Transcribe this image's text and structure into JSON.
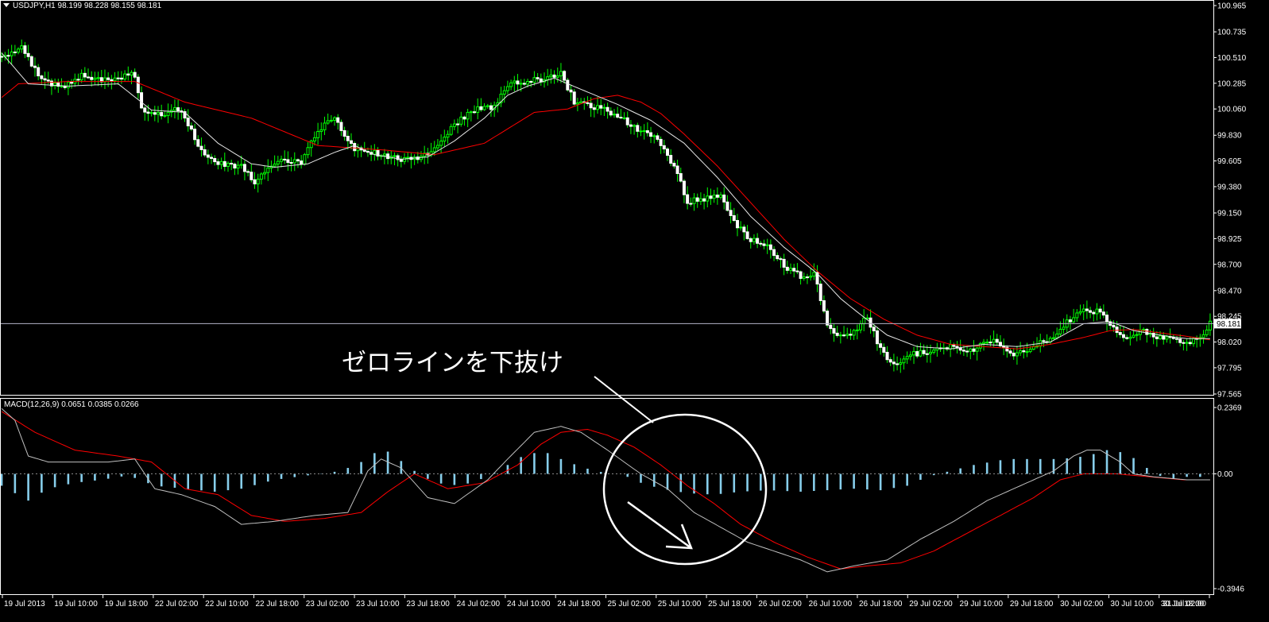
{
  "chart_data": {
    "type": "candlestick",
    "main": {
      "header": "USDJPY,H1  98.199 98.228 98.155 98.181",
      "ylim": [
        97.565,
        100.965
      ],
      "y_ticks": [
        "100.965",
        "100.735",
        "100.510",
        "100.285",
        "100.060",
        "99.830",
        "99.605",
        "99.380",
        "99.150",
        "98.925",
        "98.700",
        "98.470",
        "98.245",
        "98.020",
        "97.795",
        "97.565"
      ],
      "current_price": "98.181",
      "colors": {
        "bull": "#00ff00",
        "bear": "#ffffff",
        "ma_fast": "#e6e6e6",
        "ma_slow": "#ff0000",
        "grid": "#b4b4c8"
      },
      "close_path": [
        [
          0,
          100.52
        ],
        [
          6,
          100.6
        ],
        [
          12,
          100.3
        ],
        [
          18,
          100.25
        ],
        [
          24,
          100.35
        ],
        [
          30,
          100.32
        ],
        [
          36,
          100.34
        ],
        [
          40,
          100.36
        ],
        [
          42,
          100.05
        ],
        [
          48,
          100.02
        ],
        [
          54,
          100.06
        ],
        [
          60,
          99.68
        ],
        [
          66,
          99.58
        ],
        [
          72,
          99.56
        ],
        [
          76,
          99.42
        ],
        [
          80,
          99.54
        ],
        [
          85,
          99.62
        ],
        [
          90,
          99.58
        ],
        [
          95,
          99.88
        ],
        [
          100,
          99.98
        ],
        [
          106,
          99.7
        ],
        [
          112,
          99.68
        ],
        [
          120,
          99.62
        ],
        [
          126,
          99.64
        ],
        [
          131,
          99.74
        ],
        [
          136,
          99.93
        ],
        [
          142,
          100.05
        ],
        [
          148,
          100.08
        ],
        [
          152,
          100.28
        ],
        [
          158,
          100.3
        ],
        [
          164,
          100.33
        ],
        [
          168,
          100.38
        ],
        [
          172,
          100.12
        ],
        [
          178,
          100.08
        ],
        [
          184,
          100.02
        ],
        [
          190,
          99.9
        ],
        [
          196,
          99.82
        ],
        [
          202,
          99.56
        ],
        [
          206,
          99.25
        ],
        [
          212,
          99.28
        ],
        [
          216,
          99.3
        ],
        [
          220,
          99.06
        ],
        [
          225,
          98.92
        ],
        [
          230,
          98.88
        ],
        [
          235,
          98.68
        ],
        [
          240,
          98.6
        ],
        [
          244,
          98.62
        ],
        [
          248,
          98.15
        ],
        [
          252,
          98.06
        ],
        [
          256,
          98.1
        ],
        [
          260,
          98.25
        ],
        [
          264,
          97.95
        ],
        [
          268,
          97.82
        ],
        [
          272,
          97.9
        ],
        [
          280,
          97.95
        ],
        [
          286,
          97.98
        ],
        [
          292,
          97.95
        ],
        [
          298,
          98.05
        ],
        [
          304,
          97.92
        ],
        [
          310,
          97.98
        ],
        [
          315,
          98.05
        ],
        [
          320,
          98.2
        ],
        [
          325,
          98.3
        ],
        [
          330,
          98.28
        ],
        [
          334,
          98.13
        ],
        [
          338,
          98.03
        ],
        [
          342,
          98.12
        ],
        [
          347,
          98.05
        ],
        [
          352,
          98.06
        ],
        [
          356,
          98.02
        ],
        [
          360,
          98.05
        ],
        [
          363,
          98.181
        ]
      ],
      "sma_fast": [
        [
          0,
          100.55
        ],
        [
          8,
          100.28
        ],
        [
          20,
          100.26
        ],
        [
          35,
          100.28
        ],
        [
          45,
          100.05
        ],
        [
          55,
          100.03
        ],
        [
          65,
          99.76
        ],
        [
          75,
          99.58
        ],
        [
          82,
          99.55
        ],
        [
          92,
          99.58
        ],
        [
          100,
          99.68
        ],
        [
          106,
          99.74
        ],
        [
          112,
          99.66
        ],
        [
          120,
          99.62
        ],
        [
          128,
          99.64
        ],
        [
          136,
          99.78
        ],
        [
          145,
          99.98
        ],
        [
          152,
          100.18
        ],
        [
          158,
          100.26
        ],
        [
          166,
          100.33
        ],
        [
          175,
          100.22
        ],
        [
          185,
          100.1
        ],
        [
          195,
          99.96
        ],
        [
          205,
          99.76
        ],
        [
          215,
          99.46
        ],
        [
          225,
          99.12
        ],
        [
          235,
          98.85
        ],
        [
          245,
          98.62
        ],
        [
          252,
          98.4
        ],
        [
          258,
          98.26
        ],
        [
          266,
          98.08
        ],
        [
          275,
          97.98
        ],
        [
          285,
          97.96
        ],
        [
          295,
          98.0
        ],
        [
          305,
          97.98
        ],
        [
          315,
          98.02
        ],
        [
          325,
          98.18
        ],
        [
          333,
          98.2
        ],
        [
          340,
          98.12
        ],
        [
          348,
          98.08
        ],
        [
          356,
          98.05
        ],
        [
          363,
          98.05
        ]
      ],
      "sma_slow": [
        [
          0,
          100.16
        ],
        [
          5,
          100.28
        ],
        [
          20,
          100.3
        ],
        [
          40,
          100.3
        ],
        [
          55,
          100.12
        ],
        [
          75,
          99.98
        ],
        [
          95,
          99.74
        ],
        [
          115,
          99.7
        ],
        [
          130,
          99.66
        ],
        [
          145,
          99.76
        ],
        [
          160,
          100.03
        ],
        [
          170,
          100.06
        ],
        [
          178,
          100.15
        ],
        [
          185,
          100.18
        ],
        [
          192,
          100.12
        ],
        [
          198,
          100.02
        ],
        [
          205,
          99.84
        ],
        [
          215,
          99.56
        ],
        [
          225,
          99.24
        ],
        [
          235,
          98.92
        ],
        [
          245,
          98.64
        ],
        [
          255,
          98.4
        ],
        [
          265,
          98.22
        ],
        [
          275,
          98.08
        ],
        [
          285,
          98.0
        ],
        [
          295,
          97.98
        ],
        [
          305,
          97.96
        ],
        [
          315,
          98.0
        ],
        [
          325,
          98.06
        ],
        [
          333,
          98.12
        ],
        [
          340,
          98.13
        ],
        [
          348,
          98.1
        ],
        [
          356,
          98.07
        ],
        [
          363,
          98.04
        ]
      ]
    },
    "macd": {
      "header": "MACD(12,26,9) 0.0651 0.0385 0.0266",
      "ylim": [
        -0.3946,
        0.2369
      ],
      "y_ticks": [
        "0.2369",
        "0.00",
        "-0.3946"
      ],
      "zero_label": "0.00",
      "colors": {
        "histogram": "#87ceeb",
        "signal": "#ff0000",
        "macd_line": "#c0c0c0"
      },
      "histogram_path": [
        [
          0,
          -0.04
        ],
        [
          8,
          -0.09
        ],
        [
          14,
          -0.05
        ],
        [
          22,
          -0.03
        ],
        [
          30,
          -0.02
        ],
        [
          38,
          -0.005
        ],
        [
          46,
          -0.04
        ],
        [
          55,
          -0.05
        ],
        [
          64,
          -0.06
        ],
        [
          72,
          -0.05
        ],
        [
          82,
          -0.02
        ],
        [
          92,
          -0.005
        ],
        [
          102,
          0.01
        ],
        [
          110,
          0.05
        ],
        [
          114,
          0.09
        ],
        [
          118,
          0.06
        ],
        [
          124,
          0.01
        ],
        [
          130,
          -0.03
        ],
        [
          138,
          -0.04
        ],
        [
          146,
          -0.01
        ],
        [
          152,
          0.03
        ],
        [
          158,
          0.07
        ],
        [
          164,
          0.07
        ],
        [
          170,
          0.04
        ],
        [
          178,
          0.01
        ],
        [
          184,
          0.0
        ],
        [
          188,
          -0.01
        ],
        [
          192,
          -0.03
        ],
        [
          198,
          -0.05
        ],
        [
          206,
          -0.065
        ],
        [
          214,
          -0.07
        ],
        [
          222,
          -0.06
        ],
        [
          230,
          -0.055
        ],
        [
          240,
          -0.06
        ],
        [
          248,
          -0.055
        ],
        [
          256,
          -0.05
        ],
        [
          264,
          -0.055
        ],
        [
          272,
          -0.04
        ],
        [
          278,
          -0.01
        ],
        [
          285,
          0.01
        ],
        [
          292,
          0.03
        ],
        [
          302,
          0.05
        ],
        [
          310,
          0.05
        ],
        [
          318,
          0.05
        ],
        [
          326,
          0.06
        ],
        [
          332,
          0.08
        ],
        [
          338,
          0.07
        ],
        [
          344,
          0.02
        ],
        [
          350,
          -0.02
        ],
        [
          356,
          -0.01
        ],
        [
          363,
          -0.01
        ]
      ],
      "signal_path": [
        [
          0,
          0.21
        ],
        [
          10,
          0.14
        ],
        [
          22,
          0.08
        ],
        [
          35,
          0.06
        ],
        [
          45,
          0.04
        ],
        [
          55,
          -0.05
        ],
        [
          65,
          -0.07
        ],
        [
          75,
          -0.14
        ],
        [
          85,
          -0.16
        ],
        [
          97,
          -0.15
        ],
        [
          108,
          -0.13
        ],
        [
          116,
          -0.06
        ],
        [
          124,
          0.0
        ],
        [
          134,
          -0.05
        ],
        [
          145,
          -0.03
        ],
        [
          155,
          0.03
        ],
        [
          162,
          0.1
        ],
        [
          168,
          0.14
        ],
        [
          176,
          0.15
        ],
        [
          182,
          0.13
        ],
        [
          190,
          0.09
        ],
        [
          198,
          0.03
        ],
        [
          206,
          -0.04
        ],
        [
          214,
          -0.1
        ],
        [
          222,
          -0.17
        ],
        [
          232,
          -0.23
        ],
        [
          242,
          -0.28
        ],
        [
          252,
          -0.32
        ],
        [
          260,
          -0.31
        ],
        [
          270,
          -0.3
        ],
        [
          280,
          -0.26
        ],
        [
          290,
          -0.2
        ],
        [
          300,
          -0.14
        ],
        [
          310,
          -0.08
        ],
        [
          318,
          -0.02
        ],
        [
          325,
          0.0
        ],
        [
          335,
          0.0
        ],
        [
          345,
          -0.01
        ],
        [
          355,
          -0.02
        ],
        [
          363,
          -0.02
        ]
      ],
      "macd_line_path": [
        [
          0,
          0.22
        ],
        [
          4,
          0.18
        ],
        [
          8,
          0.06
        ],
        [
          14,
          0.04
        ],
        [
          24,
          0.04
        ],
        [
          32,
          0.04
        ],
        [
          40,
          0.05
        ],
        [
          46,
          -0.05
        ],
        [
          54,
          -0.07
        ],
        [
          64,
          -0.11
        ],
        [
          72,
          -0.17
        ],
        [
          82,
          -0.16
        ],
        [
          94,
          -0.14
        ],
        [
          104,
          -0.13
        ],
        [
          110,
          0.01
        ],
        [
          114,
          0.05
        ],
        [
          120,
          0.02
        ],
        [
          128,
          -0.08
        ],
        [
          136,
          -0.1
        ],
        [
          146,
          -0.02
        ],
        [
          152,
          0.05
        ],
        [
          160,
          0.14
        ],
        [
          168,
          0.16
        ],
        [
          174,
          0.14
        ],
        [
          182,
          0.08
        ],
        [
          192,
          0.0
        ],
        [
          200,
          -0.05
        ],
        [
          208,
          -0.13
        ],
        [
          216,
          -0.18
        ],
        [
          224,
          -0.23
        ],
        [
          232,
          -0.26
        ],
        [
          240,
          -0.29
        ],
        [
          248,
          -0.33
        ],
        [
          256,
          -0.31
        ],
        [
          266,
          -0.29
        ],
        [
          276,
          -0.22
        ],
        [
          286,
          -0.16
        ],
        [
          296,
          -0.09
        ],
        [
          306,
          -0.04
        ],
        [
          316,
          0.01
        ],
        [
          322,
          0.06
        ],
        [
          326,
          0.08
        ],
        [
          330,
          0.08
        ],
        [
          336,
          0.04
        ],
        [
          340,
          0.0
        ],
        [
          346,
          -0.01
        ],
        [
          356,
          -0.02
        ],
        [
          363,
          -0.02
        ]
      ]
    },
    "x_ticks": [
      "19 Jul 2013",
      "19 Jul 10:00",
      "19 Jul 18:00",
      "22 Jul 02:00",
      "22 Jul 10:00",
      "22 Jul 18:00",
      "23 Jul 02:00",
      "23 Jul 10:00",
      "23 Jul 18:00",
      "24 Jul 02:00",
      "24 Jul 10:00",
      "24 Jul 18:00",
      "25 Jul 02:00",
      "25 Jul 10:00",
      "25 Jul 18:00",
      "26 Jul 02:00",
      "26 Jul 10:00",
      "26 Jul 18:00",
      "29 Jul 02:00",
      "29 Jul 10:00",
      "29 Jul 18:00",
      "30 Jul 02:00",
      "30 Jul 10:00",
      "30 Jul 18:00",
      "31 Jul 02:00"
    ],
    "annotation": {
      "text": "ゼロラインを下抜け"
    }
  }
}
